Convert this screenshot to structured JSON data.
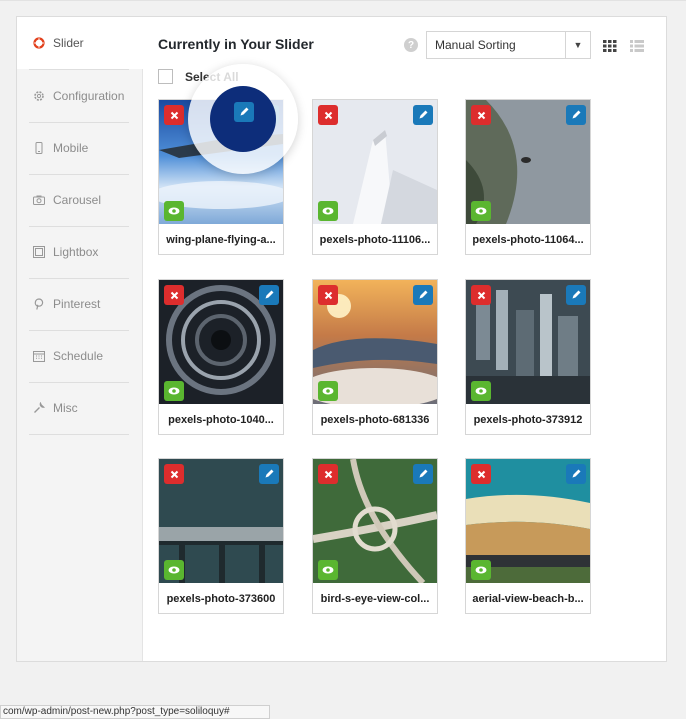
{
  "sidebar": {
    "items": [
      {
        "label": "Slider",
        "icon": "lifebuoy-icon",
        "active": true
      },
      {
        "label": "Configuration",
        "icon": "gear-icon"
      },
      {
        "label": "Mobile",
        "icon": "phone-icon"
      },
      {
        "label": "Carousel",
        "icon": "camera-icon"
      },
      {
        "label": "Lightbox",
        "icon": "gallery-icon"
      },
      {
        "label": "Pinterest",
        "icon": "pinterest-icon"
      },
      {
        "label": "Schedule",
        "icon": "calendar-icon"
      },
      {
        "label": "Misc",
        "icon": "wrench-icon"
      }
    ]
  },
  "main": {
    "title": "Currently in Your Slider",
    "help": "?",
    "sort_select": {
      "value": "Manual Sorting",
      "arrow": "▼"
    },
    "select_all_label": "Select All"
  },
  "images": [
    {
      "caption": "wing-plane-flying-a..."
    },
    {
      "caption": "pexels-photo-11106..."
    },
    {
      "caption": "pexels-photo-11064..."
    },
    {
      "caption": "pexels-photo-1040..."
    },
    {
      "caption": "pexels-photo-681336"
    },
    {
      "caption": "pexels-photo-373912"
    },
    {
      "caption": "pexels-photo-373600"
    },
    {
      "caption": "bird-s-eye-view-col..."
    },
    {
      "caption": "aerial-view-beach-b..."
    }
  ],
  "status_bar": "com/wp-admin/post-new.php?post_type=soliloquy#",
  "colors": {
    "delete": "#dd2d2d",
    "edit": "#1a79b9",
    "view": "#5ab630",
    "accent": "#e2401c"
  }
}
